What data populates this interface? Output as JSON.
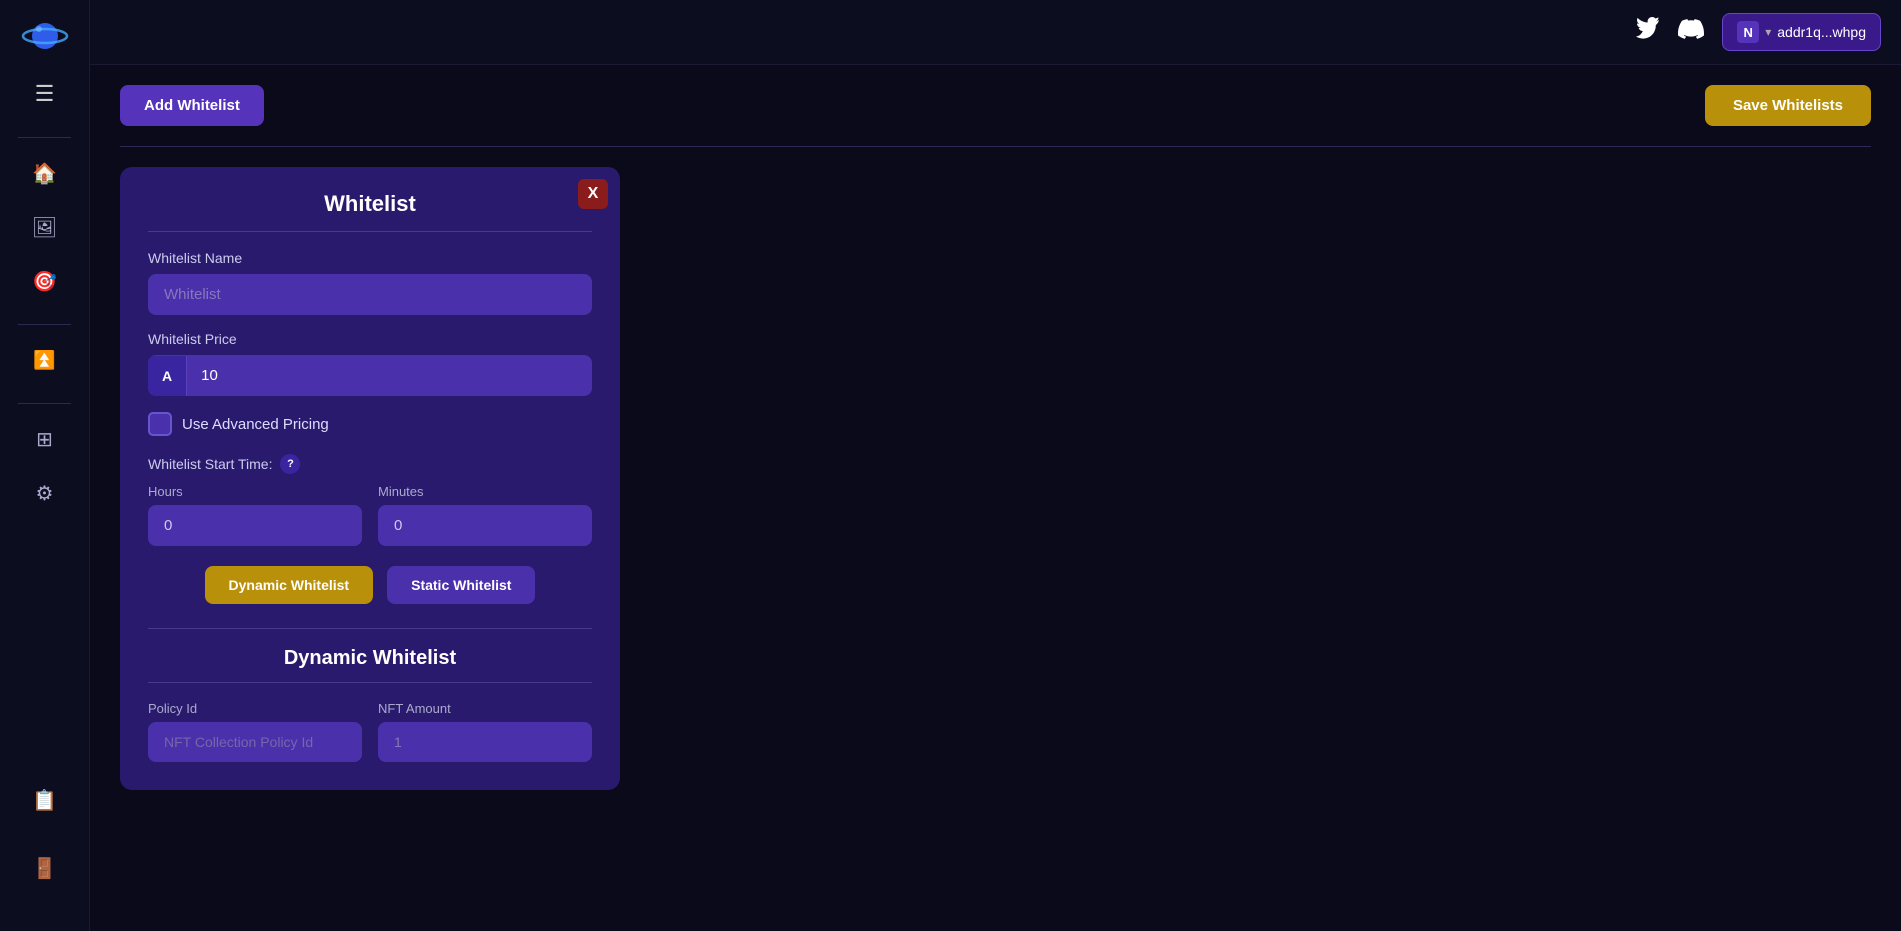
{
  "sidebar": {
    "icons": [
      {
        "name": "home-icon",
        "symbol": "🏠"
      },
      {
        "name": "image-icon",
        "symbol": "🖼"
      },
      {
        "name": "target-icon",
        "symbol": "🎯"
      },
      {
        "name": "chevron-up-icon",
        "symbol": "⏫"
      },
      {
        "name": "grid-icon",
        "symbol": "⊞"
      },
      {
        "name": "settings-icon",
        "symbol": "⚙"
      }
    ],
    "bottom_icons": [
      {
        "name": "document-icon",
        "symbol": "📋"
      },
      {
        "name": "logout-icon",
        "symbol": "🚪"
      }
    ]
  },
  "topbar": {
    "twitter_label": "Twitter",
    "discord_label": "Discord",
    "wallet_label": "N",
    "wallet_address": "addr1q...whpg"
  },
  "actions": {
    "add_whitelist_label": "Add Whitelist",
    "save_whitelists_label": "Save Whitelists"
  },
  "card": {
    "title": "Whitelist",
    "close_label": "X",
    "whitelist_name_label": "Whitelist Name",
    "whitelist_name_placeholder": "Whitelist",
    "whitelist_price_label": "Whitelist Price",
    "price_ada_badge": "A",
    "price_value": "10",
    "advanced_pricing_label": "Use Advanced Pricing",
    "start_time_label": "Whitelist Start Time:",
    "help_label": "?",
    "hours_label": "Hours",
    "hours_value": "0",
    "minutes_label": "Minutes",
    "minutes_value": "0",
    "dynamic_btn_label": "Dynamic Whitelist",
    "static_btn_label": "Static Whitelist",
    "dynamic_section_title": "Dynamic Whitelist",
    "policy_id_label": "Policy Id",
    "policy_id_placeholder": "NFT Collection Policy Id",
    "nft_amount_label": "NFT Amount",
    "nft_amount_value": "1"
  }
}
